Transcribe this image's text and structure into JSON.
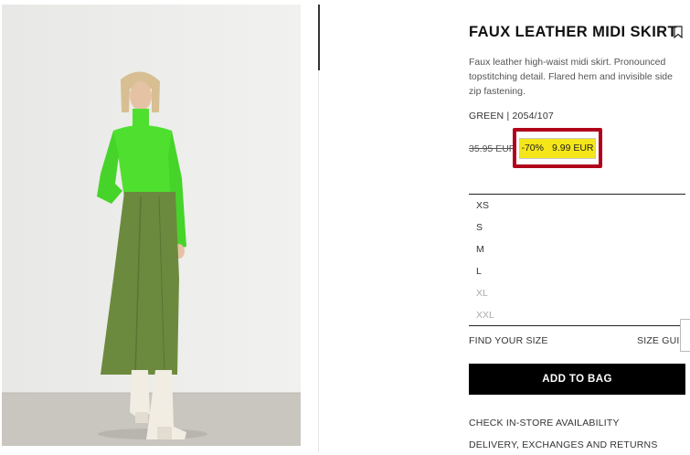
{
  "product": {
    "title": "FAUX LEATHER MIDI SKIRT",
    "description": "Faux leather high-waist midi skirt. Pronounced topstitching detail. Flared hem and invisible side zip fastening.",
    "color_ref": "GREEN | 2054/107",
    "old_price": "35.95 EUR",
    "discount": "-70%",
    "new_price": "9.99 EUR"
  },
  "sizes": [
    {
      "label": "XS",
      "available": true
    },
    {
      "label": "S",
      "available": true
    },
    {
      "label": "M",
      "available": true
    },
    {
      "label": "L",
      "available": true
    },
    {
      "label": "XL",
      "available": false
    },
    {
      "label": "XXL",
      "available": false
    }
  ],
  "links": {
    "find_size": "FIND YOUR SIZE",
    "size_guide": "SIZE GUIDE",
    "store_availability": "CHECK IN-STORE AVAILABILITY",
    "delivery": "DELIVERY, EXCHANGES AND RETURNS"
  },
  "buttons": {
    "add_to_bag": "ADD TO BAG"
  },
  "icons": {
    "bookmark": "bookmark-icon"
  },
  "colors": {
    "highlight_fill": "#f5e61a",
    "highlight_border": "#b0001a",
    "button_bg": "#000000"
  }
}
